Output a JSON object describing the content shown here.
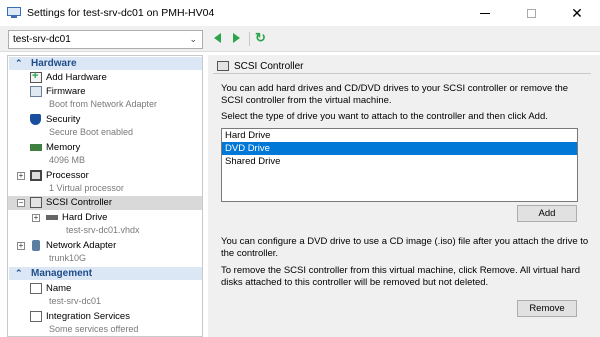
{
  "window": {
    "title": "Settings for test-srv-dc01 on PMH-HV04",
    "minimize": "",
    "maximize": "",
    "close": "✕"
  },
  "toolbar": {
    "vm_selected": "test-srv-dc01",
    "refresh": "↻"
  },
  "tree": {
    "hardware_header": "Hardware",
    "management_header": "Management",
    "items": [
      {
        "label": "Add Hardware",
        "sub": ""
      },
      {
        "label": "Firmware",
        "sub": "Boot from Network Adapter"
      },
      {
        "label": "Security",
        "sub": "Secure Boot enabled"
      },
      {
        "label": "Memory",
        "sub": "4096 MB"
      },
      {
        "label": "Processor",
        "sub": "1 Virtual processor"
      },
      {
        "label": "SCSI Controller",
        "sub": ""
      },
      {
        "label": "Hard Drive",
        "sub": "test-srv-dc01.vhdx"
      },
      {
        "label": "Network Adapter",
        "sub": "trunk10G"
      },
      {
        "label": "Name",
        "sub": "test-srv-dc01"
      },
      {
        "label": "Integration Services",
        "sub": "Some services offered"
      }
    ]
  },
  "panel": {
    "title": "SCSI Controller",
    "intro": "You can add hard drives and CD/DVD drives to your SCSI controller or remove the SCSI controller from the virtual machine.",
    "select_prompt": "Select the type of drive you want to attach to the controller and then click Add.",
    "drive_types": [
      "Hard Drive",
      "DVD Drive",
      "Shared Drive"
    ],
    "selected_drive": "DVD Drive",
    "add_label": "Add",
    "dvd_note": "You can configure a DVD drive to use a CD image (.iso) file after you attach the drive to the controller.",
    "remove_note": "To remove the SCSI controller from this virtual machine, click Remove. All virtual hard disks attached to this controller will be removed but not deleted.",
    "remove_label": "Remove"
  }
}
